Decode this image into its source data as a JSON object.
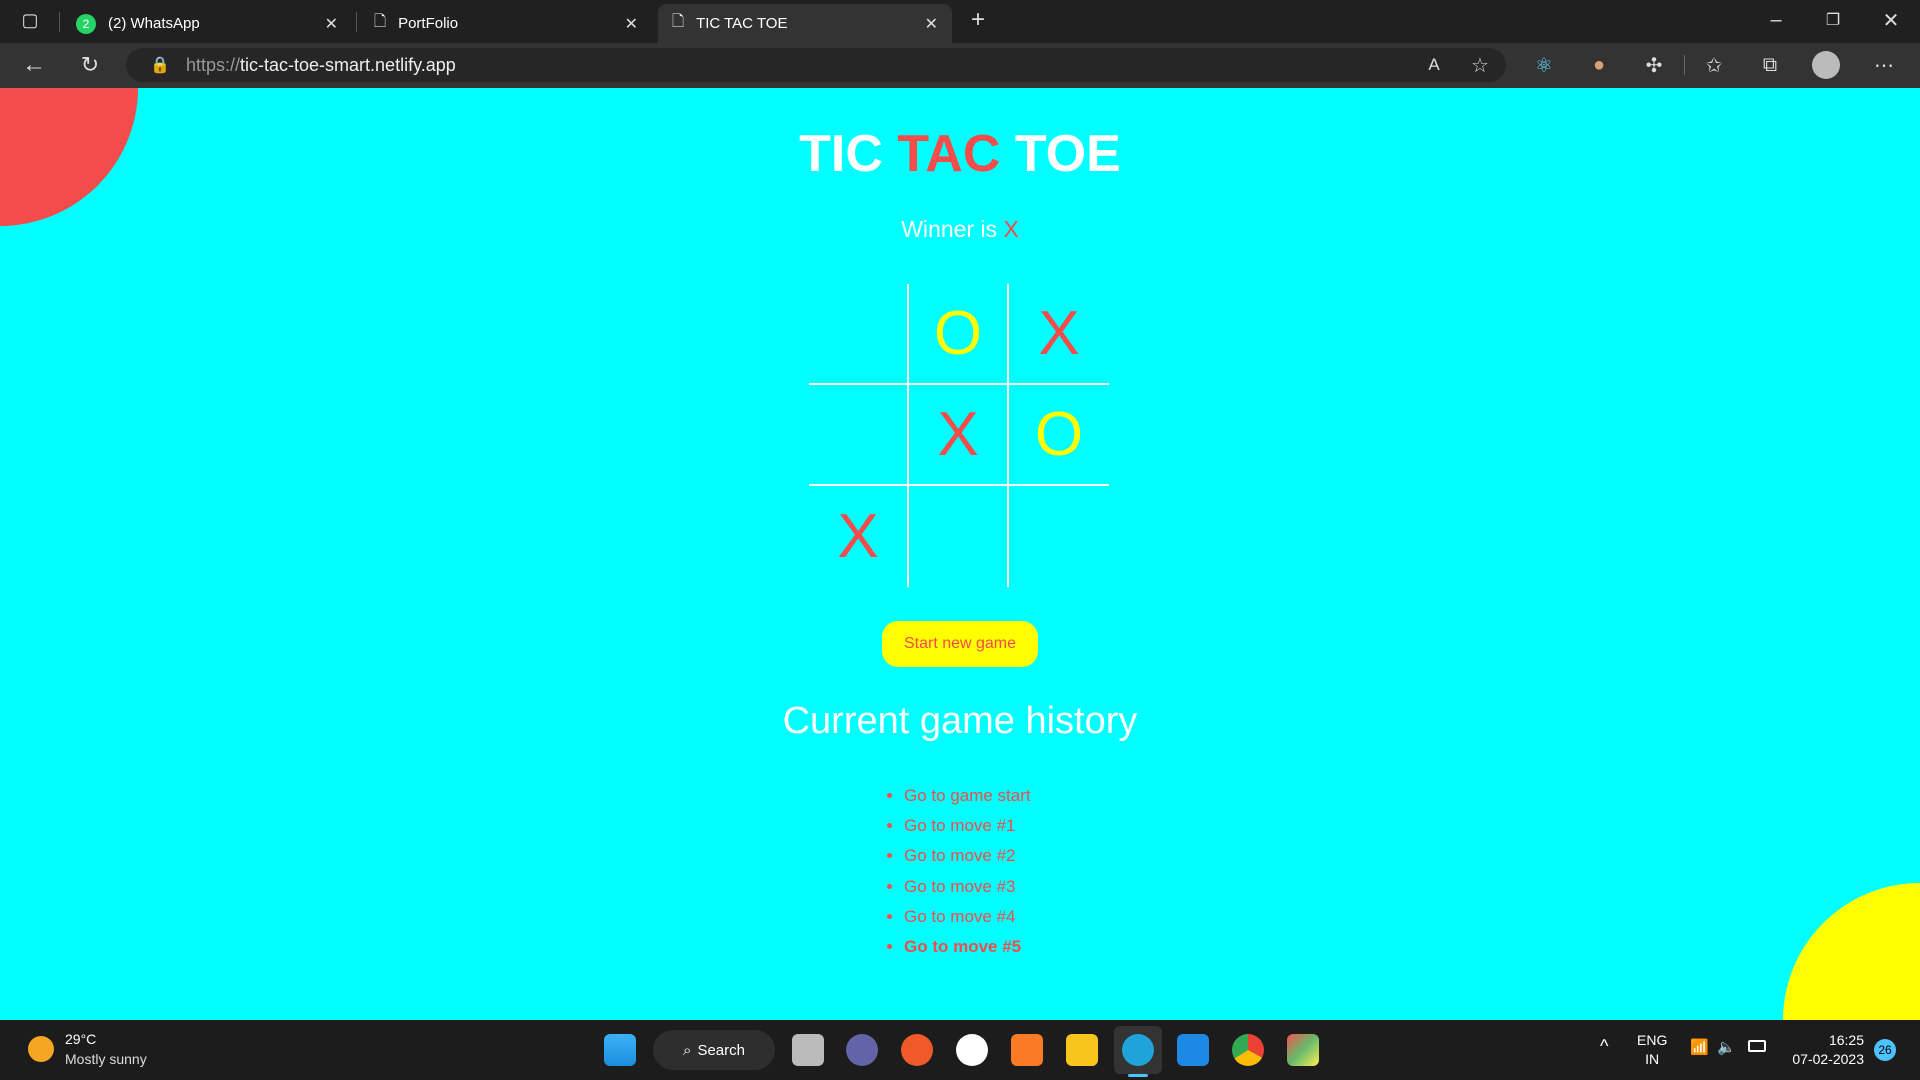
{
  "browser": {
    "tabs": [
      {
        "label": "(2) WhatsApp",
        "badge": "2",
        "icon": "whatsapp-icon"
      },
      {
        "label": "PortFolio",
        "icon": "page-icon"
      },
      {
        "label": "TIC TAC TOE",
        "icon": "page-icon",
        "active": true
      }
    ],
    "url_protocol": "https://",
    "url_host": "tic-tac-toe-smart.netlify.app"
  },
  "page": {
    "title_part1": "TIC ",
    "title_part2": "TAC",
    "title_part3": " TOE",
    "winner_label": "Winner is ",
    "winner_value": "X",
    "board": [
      "",
      "O",
      "X",
      "",
      "X",
      "O",
      "X",
      "",
      ""
    ],
    "new_game_label": "Start new game",
    "history_title": "Current game history",
    "history": [
      "Go to game start",
      "Go to move #1",
      "Go to move #2",
      "Go to move #3",
      "Go to move #4",
      "Go to move #5"
    ],
    "colors": {
      "background": "#00ffff",
      "accent_red": "#f44b4b",
      "accent_yellow": "#ffff00"
    }
  },
  "taskbar": {
    "weather_temp": "29°C",
    "weather_desc": "Mostly sunny",
    "search_label": "Search",
    "lang": "ENG",
    "region": "IN",
    "time": "16:25",
    "date": "07-02-2023",
    "notification_count": "26"
  }
}
